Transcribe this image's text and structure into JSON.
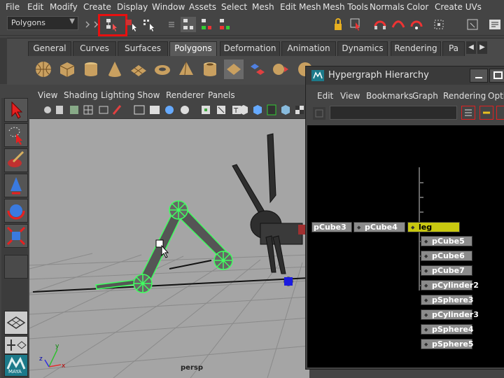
{
  "menubar": {
    "items": [
      "File",
      "Edit",
      "Modify",
      "Create",
      "Display",
      "Window",
      "Assets",
      "Select",
      "Mesh",
      "Edit Mesh",
      "Mesh Tools",
      "Normals",
      "Color",
      "Create UVs"
    ]
  },
  "statusline": {
    "mode_value": "Polygons"
  },
  "shelf": {
    "tabs": [
      "General",
      "Curves",
      "Surfaces",
      "Polygons",
      "Deformation",
      "Animation",
      "Dynamics",
      "Rendering",
      "Pa"
    ],
    "active_tab": "Polygons"
  },
  "viewport": {
    "menu": [
      "View",
      "Shading",
      "Lighting",
      "Show",
      "Renderer",
      "Panels"
    ],
    "camera_label": "persp",
    "axis_x": "x",
    "axis_y": "y",
    "axis_z": "z"
  },
  "hypergraph": {
    "title": "Hypergraph Hierarchy",
    "menu": [
      "Edit",
      "View",
      "Bookmarks",
      "Graph",
      "Rendering",
      "Optio"
    ],
    "top_nodes": [
      {
        "label": "pCube3"
      },
      {
        "label": "pCube4"
      },
      {
        "label": "leg",
        "selected": true
      }
    ],
    "child_nodes": [
      "pCube5",
      "pCube6",
      "pCube7",
      "pCylinder2",
      "pSphere3",
      "pCylinder3",
      "pSphere4",
      "pSphere5"
    ]
  },
  "toolbox": {
    "logo_text": "MAYA"
  },
  "colors": {
    "highlight_red": "#e81010",
    "selection_green": "#40ff60",
    "selected_node": "#c8c810"
  }
}
